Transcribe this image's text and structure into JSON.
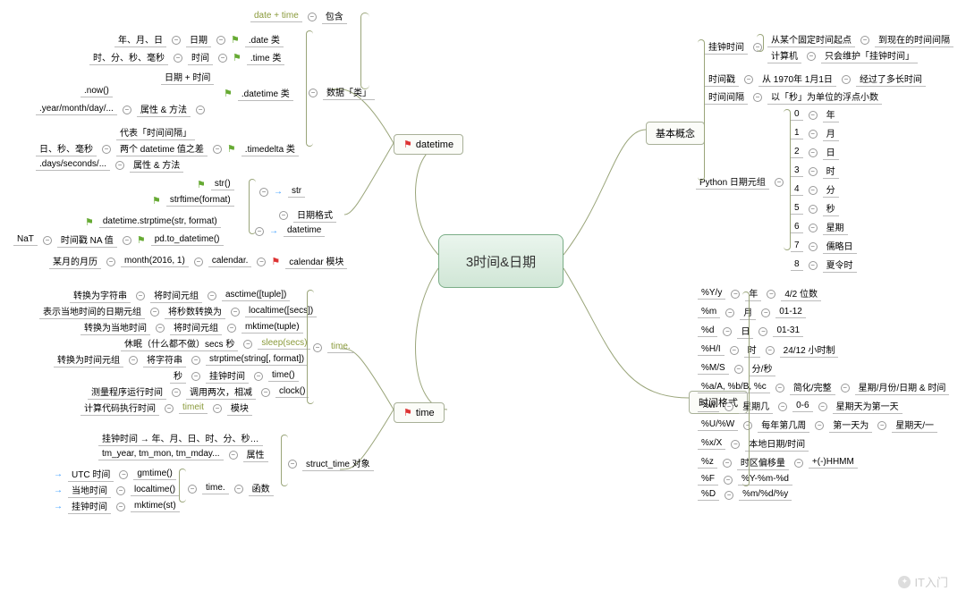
{
  "root": "3时间&日期",
  "branches": {
    "datetime": "datetime",
    "time": "time",
    "basic": "基本概念",
    "format": "时间格式"
  },
  "dt": {
    "contain": {
      "head": "date + time",
      "label": "包含"
    },
    "classes": {
      "label": "数据「类」",
      "date": {
        "l1": "年、月、日",
        "l2": "日期",
        "klass": ".date 类"
      },
      "time": {
        "l1": "时、分、秒、毫秒",
        "l2": "时间",
        "klass": ".time 类"
      },
      "datetime": {
        "head": "日期 + 时间",
        "now": ".now()",
        "ymd": ".year/month/day/...",
        "attr": "属性 & 方法",
        "klass": ".datetime 类"
      },
      "timedelta": {
        "head": "代表「时间间隔」",
        "diff": "日、秒、毫秒",
        "two": "两个 datetime 值之差",
        "days": ".days/seconds/...",
        "attr": "属性 & 方法",
        "klass": ".timedelta 类"
      }
    },
    "fmt": {
      "label": "日期格式",
      "tostr": {
        "f1": "str()",
        "f2": "strftime(format)",
        "arrow": "str"
      },
      "todt": {
        "f1": "datetime.strptime(str, format)",
        "f2": "pd.to_datetime()",
        "na": "时间戳 NA 值",
        "nat": "NaT",
        "arrow": "datetime"
      }
    },
    "cal": {
      "label": "calendar 模块",
      "mon": "某月的月历",
      "fn": "month(2016, 1)",
      "mod": "calendar."
    }
  },
  "tm": {
    "mod": {
      "label": "time.",
      "asctime": {
        "a": "转换为字符串",
        "b": "将时间元组",
        "c": "asctime([tuple])"
      },
      "localtime": {
        "a": "表示当地时间的日期元组",
        "b": "将秒数转换为",
        "c": "localtime([secs])"
      },
      "mktime": {
        "a": "转换为当地时间",
        "b": "将时间元组",
        "c": "mktime(tuple)"
      },
      "sleep": {
        "a": "休眠（什么都不做）secs 秒",
        "c": "sleep(secs)"
      },
      "strptime": {
        "a": "转换为时间元组",
        "b": "将字符串",
        "c": "strptime(string[, format])"
      },
      "time": {
        "a": "秒",
        "b": "挂钟时间",
        "c": "time()"
      },
      "clock": {
        "a": "测量程序运行时间",
        "b": "调用两次，相减",
        "c": "clock()"
      },
      "timeit": {
        "a": "计算代码执行时间",
        "b": "timeit",
        "c": "模块"
      }
    },
    "struct": {
      "label": "struct_time 对象",
      "attr": {
        "a": "挂钟时间 → 年、月、日、时、分、秒…",
        "b": "tm_year, tm_mon, tm_mday...",
        "c": "属性"
      },
      "fn": {
        "label": "函数",
        "mod": "time.",
        "gm": {
          "a": "UTC 时间",
          "b": "gmtime()"
        },
        "lt": {
          "a": "当地时间",
          "b": "localtime()"
        },
        "mk": {
          "a": "挂钟时间",
          "b": "mktime(st)"
        }
      }
    }
  },
  "basic": {
    "wall": {
      "label": "挂钟时间",
      "a": "从某个固定时间起点",
      "b": "到现在的时间间隔",
      "c": "计算机",
      "d": "只会维护「挂钟时间」"
    },
    "ts": {
      "label": "时间戳",
      "a": "从 1970年 1月1日",
      "b": "经过了多长时间"
    },
    "delta": {
      "label": "时间间隔",
      "a": "以「秒」为单位的浮点小数"
    },
    "tuple": {
      "label": "Python 日期元组",
      "rows": [
        {
          "i": "0",
          "n": "年"
        },
        {
          "i": "1",
          "n": "月"
        },
        {
          "i": "2",
          "n": "日"
        },
        {
          "i": "3",
          "n": "时"
        },
        {
          "i": "4",
          "n": "分"
        },
        {
          "i": "5",
          "n": "秒"
        },
        {
          "i": "6",
          "n": "星期"
        },
        {
          "i": "7",
          "n": "儒略日"
        },
        {
          "i": "8",
          "n": "夏令时"
        }
      ]
    }
  },
  "fmt": {
    "rows": [
      {
        "c": "%Y/y",
        "n": "年",
        "d": "4/2 位数"
      },
      {
        "c": "%m",
        "n": "月",
        "d": "01-12"
      },
      {
        "c": "%d",
        "n": "日",
        "d": "01-31"
      },
      {
        "c": "%H/I",
        "n": "时",
        "d": "24/12 小时制"
      },
      {
        "c": "%M/S",
        "n": "分/秒",
        "d": ""
      },
      {
        "c": "%a/A, %b/B, %c",
        "n": "简化/完整",
        "d": "星期/月份/日期 & 时间"
      },
      {
        "c": "%w",
        "n": "星期几",
        "d": "0-6",
        "e": "星期天为第一天"
      },
      {
        "c": "%U/%W",
        "n": "每年第几周",
        "d": "第一天为",
        "e": "星期天/一"
      },
      {
        "c": "%x/X",
        "n": "本地日期/时间",
        "d": ""
      },
      {
        "c": "%z",
        "n": "时区偏移量",
        "d": "+(-)HHMM"
      },
      {
        "c": "%F",
        "n": "%Y-%m-%d",
        "d": ""
      },
      {
        "c": "%D",
        "n": "%m/%d/%y",
        "d": ""
      }
    ]
  },
  "watermark": "IT入门"
}
